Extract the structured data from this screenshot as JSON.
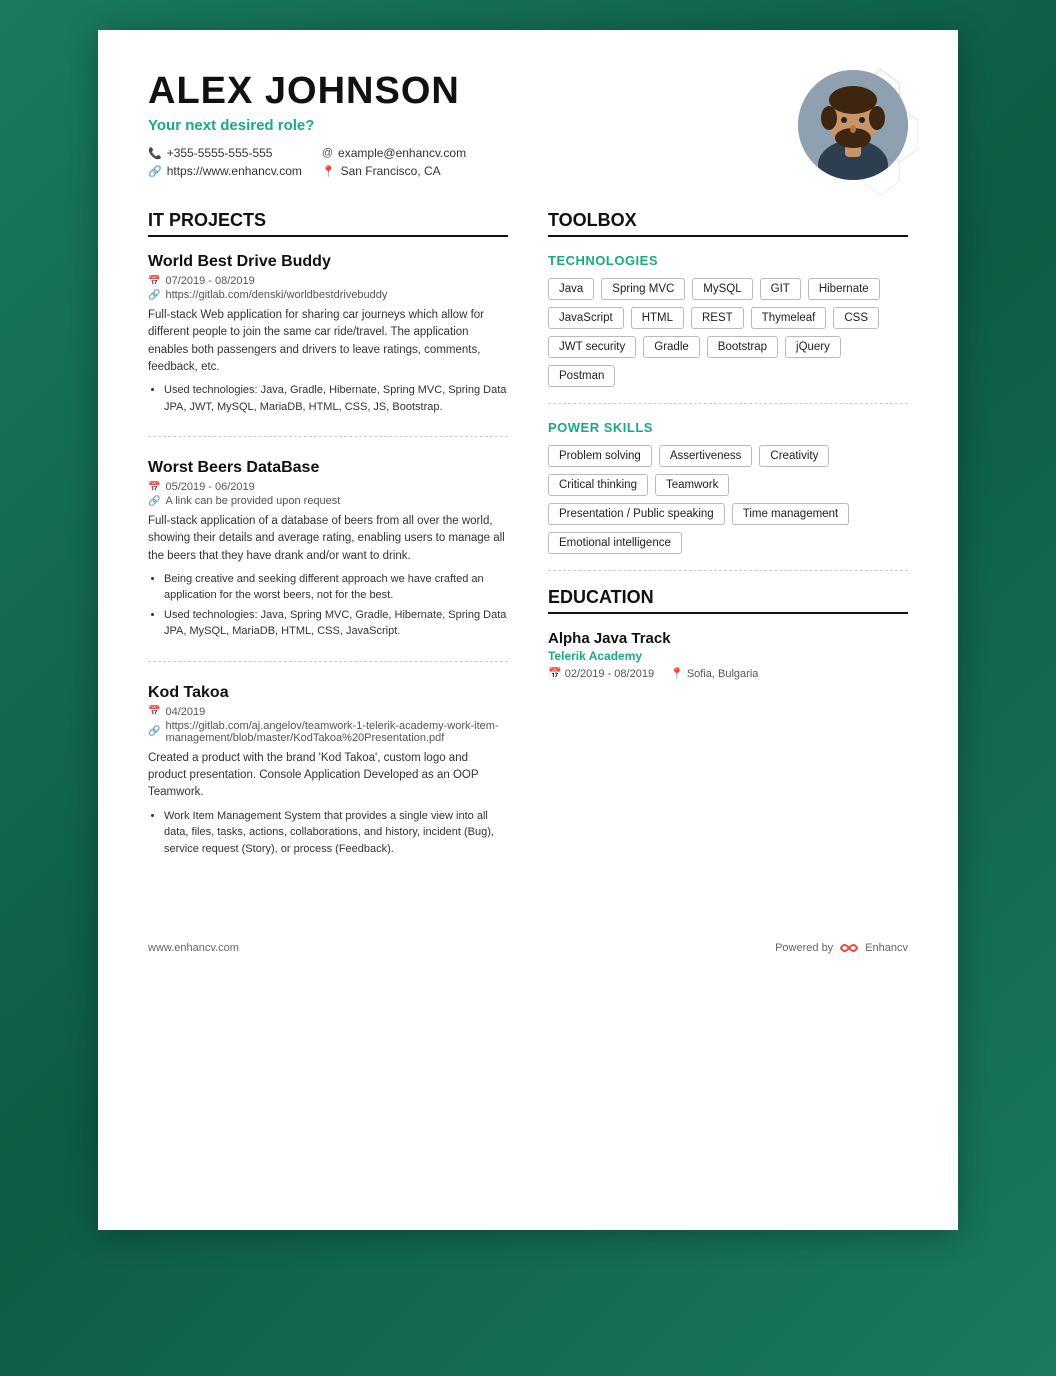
{
  "header": {
    "name": "ALEX JOHNSON",
    "role": "Your next desired role?",
    "phone": "+355-5555-555-555",
    "website": "https://www.enhancv.com",
    "email": "example@enhancv.com",
    "location": "San Francisco, CA"
  },
  "it_projects": {
    "section_title": "IT PROJECTS",
    "projects": [
      {
        "title": "World Best Drive Buddy",
        "date": "07/2019 - 08/2019",
        "link": "https://gitlab.com/denski/worldbestdrivebuddy",
        "description": "Full-stack Web application for sharing car journeys which allow for different people to join the same car ride/travel. The application enables both passengers and drivers to leave ratings, comments, feedback, etc.",
        "bullets": [
          "Used technologies: Java, Gradle, Hibernate, Spring MVC, Spring Data JPA, JWT, MySQL, MariaDB, HTML, CSS, JS, Bootstrap."
        ]
      },
      {
        "title": "Worst Beers DataBase",
        "date": "05/2019 - 06/2019",
        "link": "A link can be provided upon request",
        "description": "Full-stack application of a database of beers from all over the world, showing their details and average rating, enabling users to manage all the beers that they have drank and/or want to drink.",
        "bullets": [
          "Being creative and seeking different approach we have crafted an application for the worst beers, not for the best.",
          "Used technologies: Java, Spring MVC, Gradle, Hibernate, Spring Data JPA, MySQL, MariaDB, HTML, CSS, JavaScript."
        ]
      },
      {
        "title": "Kod Takoa",
        "date": "04/2019",
        "link": "https://gitlab.com/aj.angelov/teamwork-1-telerik-academy-work-item-management/blob/master/KodTakoa%20Presentation.pdf",
        "description": "Created a product with the brand 'Kod Takoa', custom logo and product presentation. Console Application Developed as an OOP Teamwork.",
        "bullets": [
          "Work Item Management System that provides a single view into all data, files, tasks, actions, collaborations, and history, incident (Bug), service request (Story), or process (Feedback)."
        ]
      }
    ]
  },
  "toolbox": {
    "section_title": "TOOLBOX",
    "technologies": {
      "label": "TECHNOLOGIES",
      "tags": [
        "Java",
        "Spring MVC",
        "MySQL",
        "GIT",
        "Hibernate",
        "JavaScript",
        "HTML",
        "REST",
        "Thymeleaf",
        "CSS",
        "JWT security",
        "Gradle",
        "Bootstrap",
        "jQuery",
        "Postman"
      ]
    },
    "power_skills": {
      "label": "POWER SKILLS",
      "tags": [
        "Problem solving",
        "Assertiveness",
        "Creativity",
        "Critical thinking",
        "Teamwork",
        "Presentation / Public speaking",
        "Time management",
        "Emotional intelligence"
      ]
    }
  },
  "education": {
    "section_title": "EDUCATION",
    "items": [
      {
        "title": "Alpha Java Track",
        "school": "Telerik Academy",
        "date": "02/2019 - 08/2019",
        "location": "Sofia, Bulgaria"
      }
    ]
  },
  "footer": {
    "website": "www.enhancv.com",
    "powered_by": "Powered by",
    "brand": "Enhancv"
  }
}
